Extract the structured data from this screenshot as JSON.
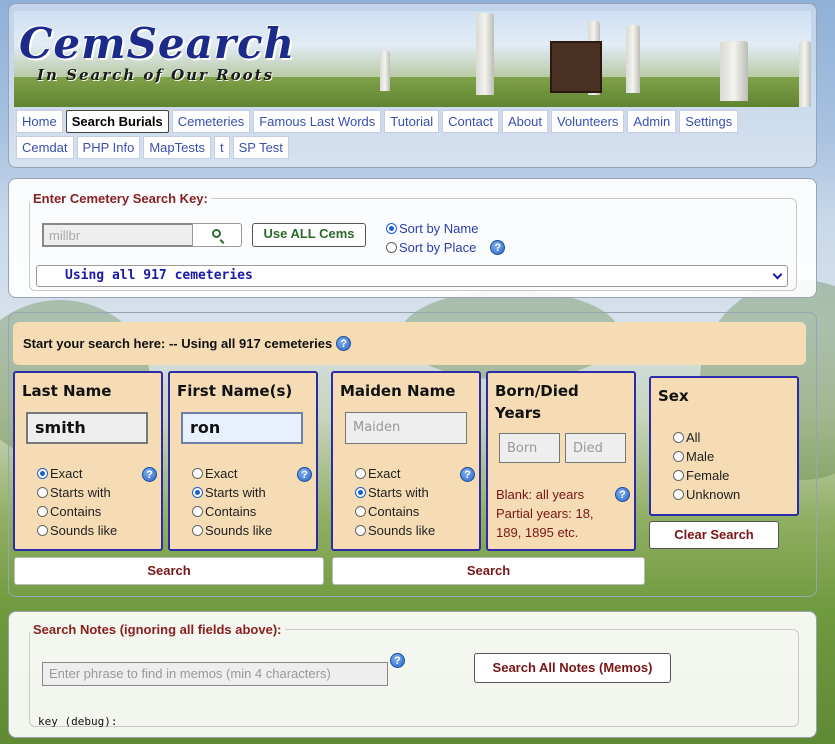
{
  "logo": {
    "title": "CemSearch",
    "subtitle": "In Search of Our Roots"
  },
  "nav": {
    "row1": [
      "Home",
      "Search Burials",
      "Cemeteries",
      "Famous Last Words",
      "Tutorial",
      "Contact",
      "About",
      "Volunteers",
      "Admin",
      "Settings"
    ],
    "row2": [
      "Cemdat",
      "PHP Info",
      "MapTests",
      "t",
      "SP Test"
    ],
    "active": "Search Burials"
  },
  "cemetery": {
    "legend": "Enter Cemetery Search Key:",
    "input_value": "millbr",
    "use_all_label": "Use ALL Cems",
    "sort_name": "Sort by Name",
    "sort_place": "Sort by Place",
    "selected_cem": "Using all 917 cemeteries"
  },
  "search": {
    "start_text": "Start your search here: -- Using all 917 cemeteries",
    "last": {
      "title": "Last Name",
      "value": "smith",
      "opts": [
        "Exact",
        "Starts with",
        "Contains",
        "Sounds like"
      ],
      "selected": 0
    },
    "first": {
      "title": "First Name(s)",
      "value": "ron",
      "opts": [
        "Exact",
        "Starts with",
        "Contains",
        "Sounds like"
      ],
      "selected": 1
    },
    "maiden": {
      "title": "Maiden Name",
      "placeholder": "Maiden",
      "opts": [
        "Exact",
        "Starts with",
        "Contains",
        "Sounds like"
      ],
      "selected": 1
    },
    "born": {
      "title_1": "Born/Died",
      "title_2": "Years",
      "born_ph": "Born",
      "died_ph": "Died",
      "note_1": "Blank: all years",
      "note_2": "Partial years: 18,",
      "note_3": "189, 1895 etc."
    },
    "sex": {
      "title": "Sex",
      "opts": [
        "All",
        "Male",
        "Female",
        "Unknown"
      ]
    },
    "clear_label": "Clear Search",
    "search_label": "Search"
  },
  "notes": {
    "legend": "Search Notes (ignoring all fields above):",
    "placeholder": "Enter phrase to find in memos (min 4 characters)",
    "button": "Search All Notes (Memos)",
    "debug": "key (debug):"
  },
  "help_glyph": "?",
  "colors": {
    "accent": "#2c2ca8",
    "box_bg": "#f5dcb4",
    "legend": "#8a2121",
    "link": "#3a4fb0"
  }
}
